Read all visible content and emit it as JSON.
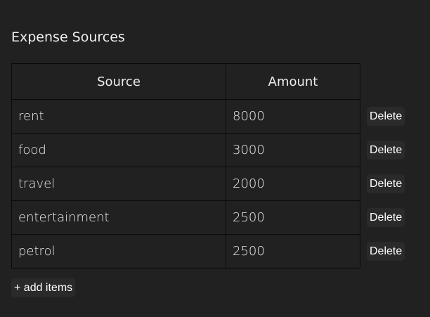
{
  "section": {
    "title": "Expense Sources"
  },
  "table": {
    "headers": [
      "Source",
      "Amount"
    ],
    "rows": [
      {
        "source": "rent",
        "amount": "8000",
        "action": "Delete"
      },
      {
        "source": "food",
        "amount": "3000",
        "action": "Delete"
      },
      {
        "source": "travel",
        "amount": "2000",
        "action": "Delete"
      },
      {
        "source": "entertainment",
        "amount": "2500",
        "action": "Delete"
      },
      {
        "source": "petrol",
        "amount": "2500",
        "action": "Delete"
      }
    ]
  },
  "add_button_label": "+ add items",
  "colors": {
    "background": "#212121",
    "border": "#0a0a0a",
    "button_bg": "#2a2a2a",
    "text": "#eeeeee"
  }
}
